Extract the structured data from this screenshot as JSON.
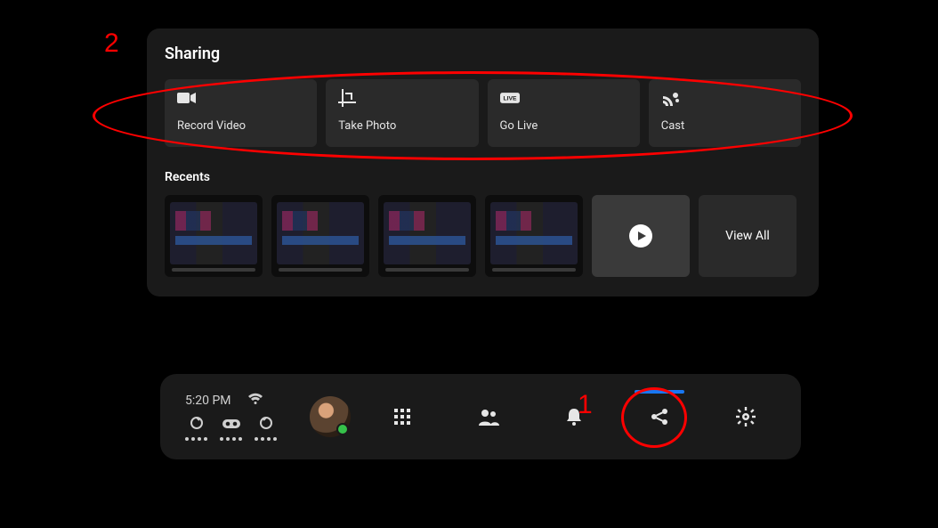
{
  "panel": {
    "title": "Sharing",
    "actions": [
      {
        "label": "Record Video",
        "icon": "record-video-icon"
      },
      {
        "label": "Take Photo",
        "icon": "crop-photo-icon"
      },
      {
        "label": "Go Live",
        "icon": "live-icon"
      },
      {
        "label": "Cast",
        "icon": "cast-icon"
      }
    ],
    "recents_title": "Recents",
    "view_all_label": "View All"
  },
  "dock": {
    "time": "5:20 PM",
    "active_index": 3
  },
  "annotations": {
    "label1": "1",
    "label2": "2"
  }
}
